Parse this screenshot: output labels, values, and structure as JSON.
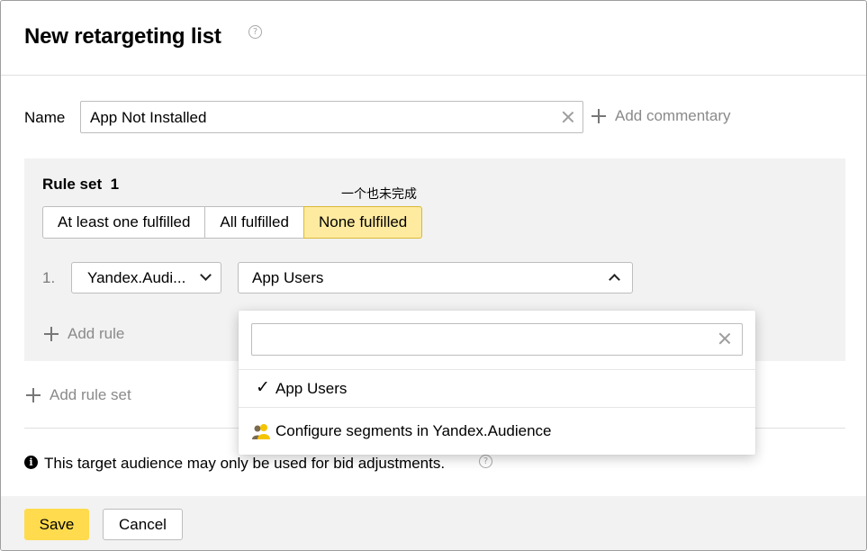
{
  "header": {
    "title": "New retargeting list",
    "help_icon": "question-circle-icon"
  },
  "name_field": {
    "label": "Name",
    "value": "App Not Installed",
    "clear_icon": "close-icon",
    "add_commentary": "Add commentary"
  },
  "rule_set": {
    "title": "Rule set",
    "number": "1",
    "tooltip": "一个也未完成",
    "modes": [
      "At least one fulfilled",
      "All fulfilled",
      "None fulfilled"
    ],
    "selected_mode": "None fulfilled",
    "rules": [
      {
        "number": "1.",
        "source": "Yandex.Audi...",
        "segment": "App Users"
      }
    ],
    "add_rule": "Add rule"
  },
  "add_rule_set": "Add rule set",
  "dropdown": {
    "search_value": "",
    "items": [
      {
        "label": "App Users",
        "selected": true,
        "icon": "checkmark-icon"
      },
      {
        "label": "Configure segments in Yandex.Audience",
        "selected": false,
        "icon": "audience-people-icon"
      }
    ]
  },
  "info": {
    "text": "This target audience may only be used for bid adjustments."
  },
  "footer": {
    "save": "Save",
    "cancel": "Cancel"
  },
  "colors": {
    "accent": "#ffdb4d",
    "selected_segment": "#ffeba0",
    "panel_bg": "#f2f2f2"
  }
}
